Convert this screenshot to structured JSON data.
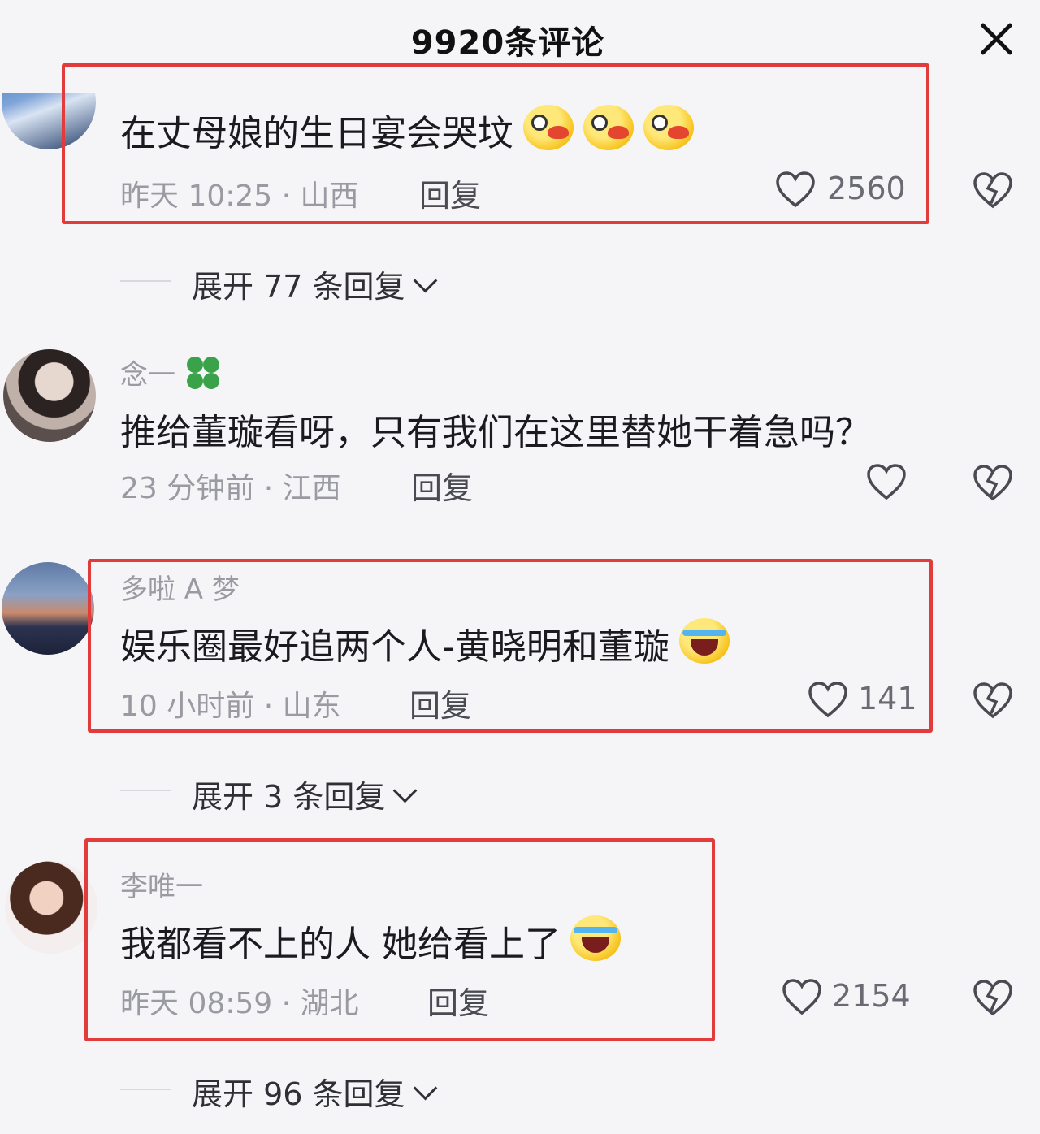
{
  "header": {
    "title": "9920条评论",
    "close_icon": "close-icon"
  },
  "comments": [
    {
      "username": "",
      "text": "在丈母娘的生日宴会哭坟",
      "emoji": "blush-emoji",
      "time_location": "昨天 10:25 · 山西",
      "reply_label": "回复",
      "likes": "2560",
      "highlighted": true
    },
    {
      "username": "念一",
      "username_icon": "four-leaf-clover-icon",
      "text": "推给董璇看呀，只有我们在这里替她干着急吗？",
      "time_location": "23 分钟前 · 江西",
      "reply_label": "回复",
      "likes": "",
      "highlighted": false
    },
    {
      "username": "多啦 A 梦",
      "text": "娱乐圈最好追两个人-黄晓明和董璇",
      "emoji": "laughing-crying-emoji",
      "time_location": "10 小时前 · 山东",
      "reply_label": "回复",
      "likes": "141",
      "highlighted": true
    },
    {
      "username": "李唯一",
      "text": "我都看不上的人 她给看上了",
      "emoji": "laughing-crying-emoji",
      "time_location": "昨天 08:59 · 湖北",
      "reply_label": "回复",
      "likes": "2154",
      "highlighted": true
    }
  ],
  "expanders": [
    {
      "label": "展开 77 条回复"
    },
    {
      "label": "展开 3 条回复"
    },
    {
      "label": "展开 96 条回复"
    }
  ],
  "colors": {
    "highlight": "#e23b3b",
    "background": "#f5f5f8",
    "meta_text": "#9a9aa2"
  }
}
